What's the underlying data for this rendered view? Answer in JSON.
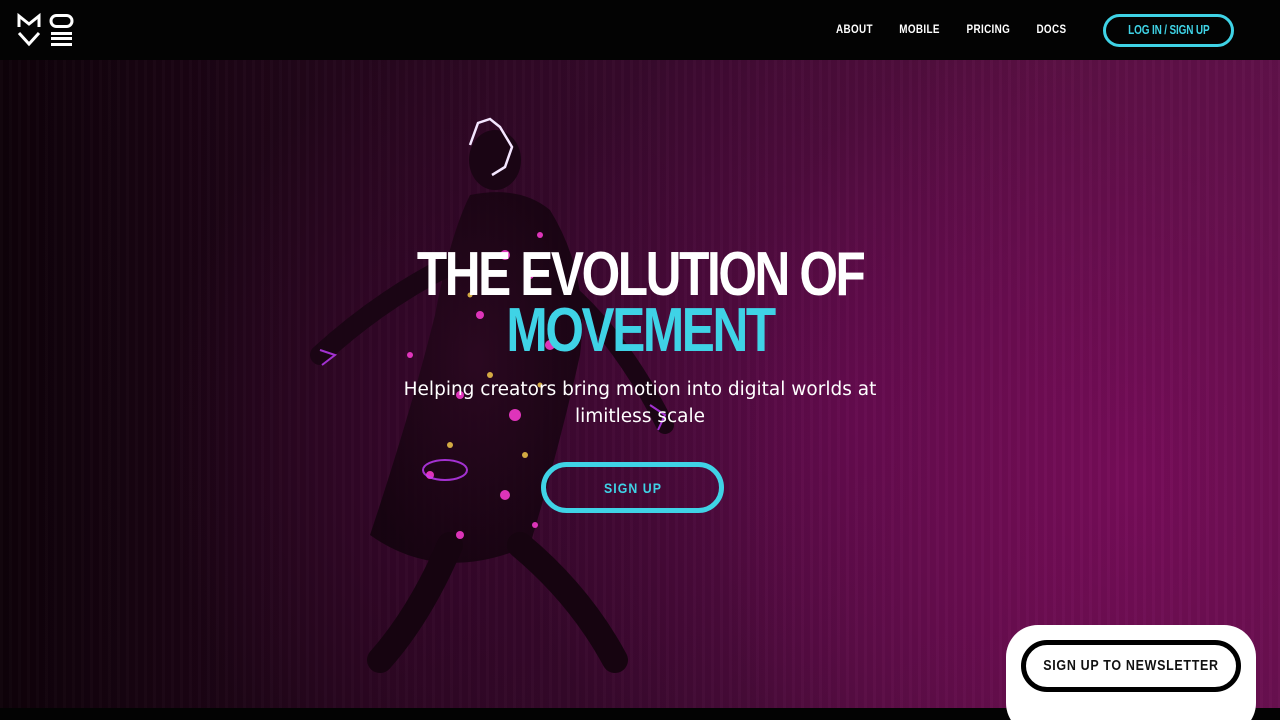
{
  "brand": {
    "logo_text": "MOVE",
    "accent": "#3fd3e6",
    "background": "#030303"
  },
  "nav": {
    "links": [
      "ABOUT",
      "MOBILE",
      "PRICING",
      "DOCS"
    ],
    "login_label": "LOG IN / SIGN UP"
  },
  "hero": {
    "title_line1": "THE EVOLUTION OF",
    "title_line2": "MOVEMENT",
    "subtitle": "Helping creators bring motion into digital worlds at limitless scale",
    "cta_label": "SIGN UP",
    "background_icon": "dancer-with-glowing-lights-image"
  },
  "newsletter": {
    "button_label": "SIGN UP TO NEWSLETTER"
  }
}
